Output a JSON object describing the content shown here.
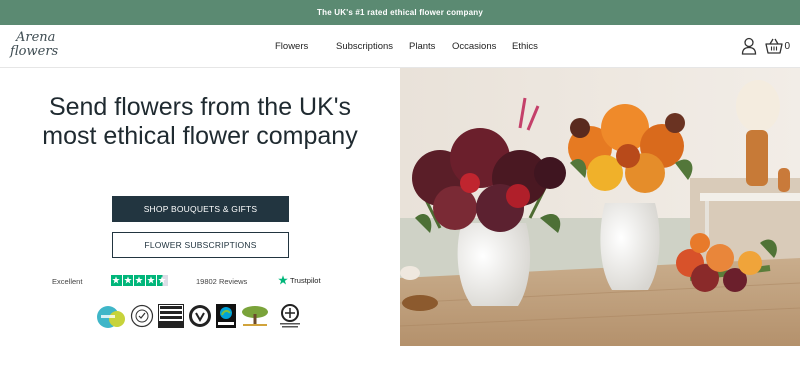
{
  "topbar": {
    "text": "The UK's #1 rated ethical flower company"
  },
  "header": {
    "logo_line1": "Arena",
    "logo_line2": "flowers",
    "nav": [
      {
        "label": "Flowers"
      },
      {
        "label": "Subscriptions"
      },
      {
        "label": "Plants"
      },
      {
        "label": "Occasions"
      },
      {
        "label": "Ethics"
      }
    ],
    "cart_count": "0"
  },
  "hero": {
    "headline": "Send flowers from the UK's most ethical flower company",
    "primary_button": "SHOP BOUQUETS & GIFTS",
    "secondary_button": "FLOWER SUBSCRIPTIONS",
    "trustpilot": {
      "rating_word": "Excellent",
      "reviews": "19802 Reviews",
      "brand": "Trustpilot",
      "stars": 4.5
    }
  },
  "colors": {
    "topbar": "#5b8a72",
    "primary_button": "#223540",
    "trustpilot_green": "#00b67a"
  }
}
